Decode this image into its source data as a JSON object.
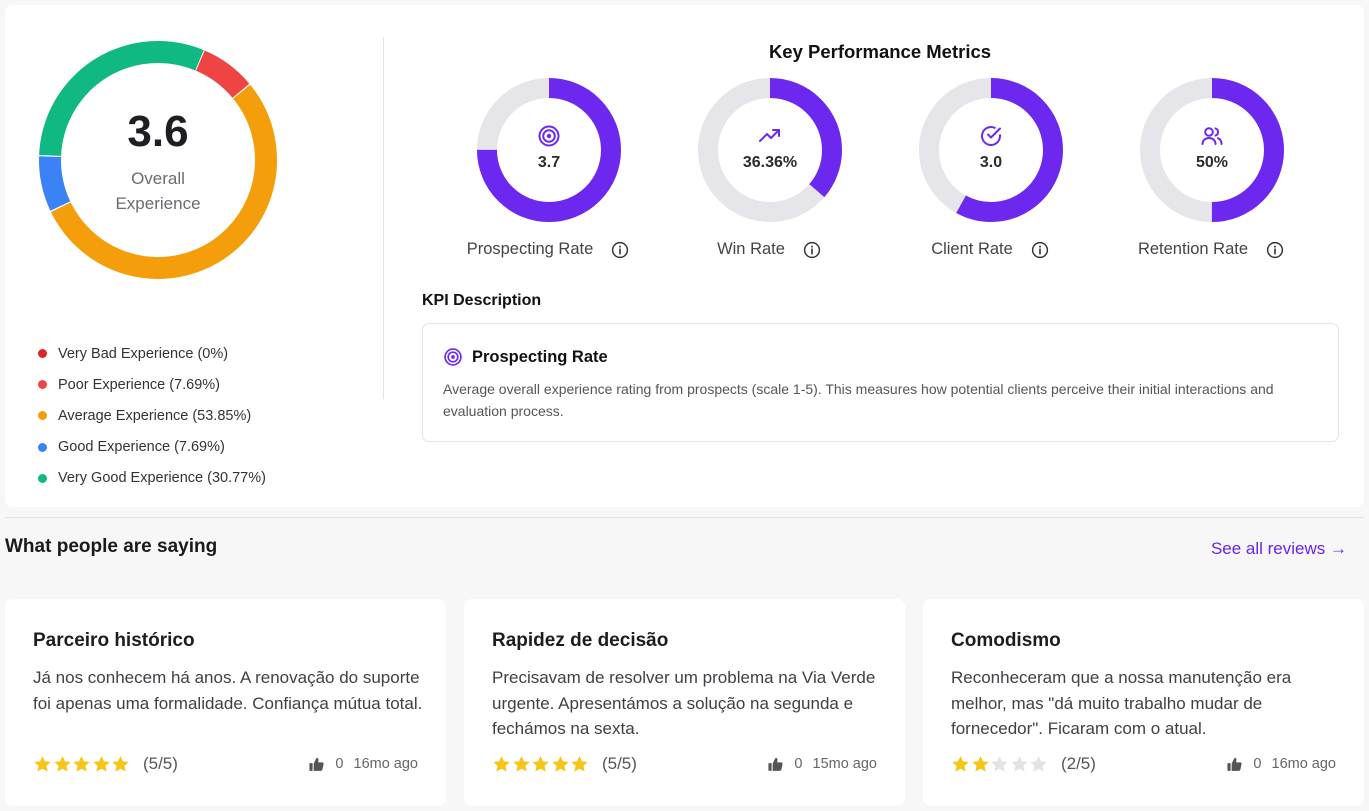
{
  "overall": {
    "score": "3.6",
    "label": "Overall Experience",
    "segments": [
      {
        "name": "Very Bad Experience",
        "percent": 0,
        "color": "#dc2626"
      },
      {
        "name": "Poor Experience",
        "percent": 7.69,
        "color": "#ef4444"
      },
      {
        "name": "Average Experience",
        "percent": 53.85,
        "color": "#f59e0b"
      },
      {
        "name": "Good Experience",
        "percent": 7.69,
        "color": "#3b82f6"
      },
      {
        "name": "Very Good Experience",
        "percent": 30.77,
        "color": "#10b981"
      }
    ],
    "legend": [
      {
        "label": "Very Bad Experience (0%)",
        "color": "#dc2626"
      },
      {
        "label": "Poor Experience (7.69%)",
        "color": "#ef4444"
      },
      {
        "label": "Average Experience (53.85%)",
        "color": "#f59e0b"
      },
      {
        "label": "Good Experience (7.69%)",
        "color": "#3b82f6"
      },
      {
        "label": "Very Good Experience (30.77%)",
        "color": "#10b981"
      }
    ]
  },
  "kpis": {
    "title": "Key Performance Metrics",
    "items": [
      {
        "value": "3.7",
        "label": "Prospecting Rate",
        "icon": "target-icon",
        "fill_fraction": 0.75
      },
      {
        "value": "36.36%",
        "label": "Win Rate",
        "icon": "trending-up-icon",
        "fill_fraction": 0.3636
      },
      {
        "value": "3.0",
        "label": "Client Rate",
        "icon": "check-circle-icon",
        "fill_fraction": 0.58
      },
      {
        "value": "50%",
        "label": "Retention Rate",
        "icon": "users-icon",
        "fill_fraction": 0.5
      }
    ],
    "accent": "#6d28f0",
    "track": "#e5e5ea"
  },
  "kpi_description": {
    "heading": "KPI Description",
    "title": "Prospecting Rate",
    "text": "Average overall experience rating from prospects (scale 1-5). This measures how potential clients perceive their initial interactions and evaluation process."
  },
  "reviews_section": {
    "title": "What people are saying",
    "see_all": "See all reviews →"
  },
  "reviews": [
    {
      "title": "Parceiro histórico",
      "text": "Já nos conhecem há anos. A renovação do suporte foi apenas uma formalidade. Confiança mútua total.",
      "stars": 5,
      "rating": "(5/5)",
      "likes": "0",
      "time": "16mo ago"
    },
    {
      "title": "Rapidez de decisão",
      "text": "Precisavam de resolver um problema na Via Verde urgente. Apresentámos a solução na segunda e fechámos na sexta.",
      "stars": 5,
      "rating": "(5/5)",
      "likes": "0",
      "time": "15mo ago"
    },
    {
      "title": "Comodismo",
      "text": "Reconheceram que a nossa manutenção era melhor, mas \"dá muito trabalho mudar de fornecedor\". Ficaram com o atual.",
      "stars": 2,
      "rating": "(2/5)",
      "likes": "0",
      "time": "16mo ago"
    }
  ]
}
